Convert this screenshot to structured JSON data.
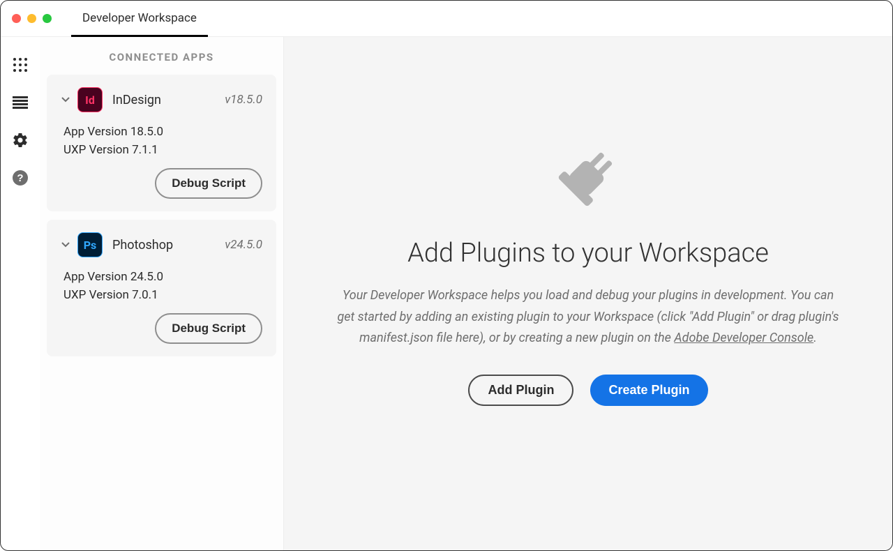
{
  "titlebar": {
    "tab_label": "Developer Workspace"
  },
  "sidebar": {
    "header": "CONNECTED APPS",
    "apps": [
      {
        "icon_badge": "Id",
        "name": "InDesign",
        "version": "v18.5.0",
        "app_version_line": "App Version 18.5.0",
        "uxp_version_line": "UXP Version 7.1.1",
        "debug_label": "Debug Script"
      },
      {
        "icon_badge": "Ps",
        "name": "Photoshop",
        "version": "v24.5.0",
        "app_version_line": "App Version 24.5.0",
        "uxp_version_line": "UXP Version 7.0.1",
        "debug_label": "Debug Script"
      }
    ]
  },
  "main": {
    "heading": "Add Plugins to your Workspace",
    "description_pre": "Your Developer Workspace helps you load and debug your plugins in development. You can get started by adding an existing plugin to your Workspace (click \"Add Plugin\" or drag plugin's manifest.json file here), or by creating a new plugin on the  ",
    "description_link": "Adobe Developer Console",
    "description_post": ".",
    "add_plugin_label": "Add Plugin",
    "create_plugin_label": "Create Plugin"
  }
}
